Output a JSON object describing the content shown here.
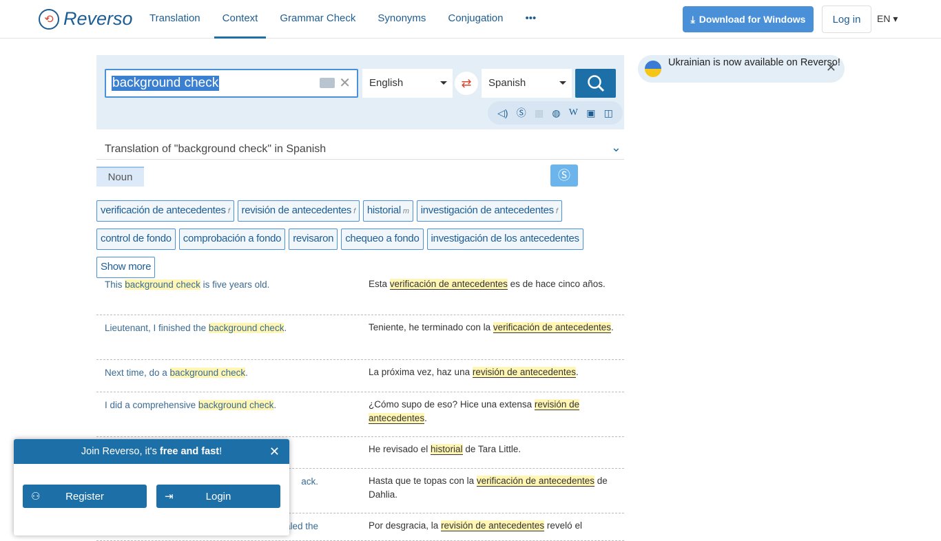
{
  "header": {
    "logo": "Reverso",
    "nav": [
      "Translation",
      "Context",
      "Grammar Check",
      "Synonyms",
      "Conjugation",
      "•••"
    ],
    "active": "Context",
    "download": "Download for Windows",
    "login": "Log in",
    "lang": "EN"
  },
  "search": {
    "query": "background check",
    "source_lang": "English",
    "target_lang": "Spanish"
  },
  "tools": [
    "speaker-icon",
    "synonyms-icon",
    "grid-icon",
    "globe-icon",
    "wikipedia-icon",
    "image-icon",
    "book-icon"
  ],
  "translation_header": "Translation of \"background check\" in Spanish",
  "pos": "Noun",
  "chips": [
    {
      "t": "verificación de antecedentes",
      "g": "f"
    },
    {
      "t": "revisión de antecedentes",
      "g": "f"
    },
    {
      "t": "historial",
      "g": "m"
    },
    {
      "t": "investigación de antecedentes",
      "g": "f"
    },
    {
      "t": "control de fondo",
      "g": ""
    },
    {
      "t": "comprobación a fondo",
      "g": ""
    },
    {
      "t": "revisaron",
      "g": ""
    },
    {
      "t": "chequeo a fondo",
      "g": ""
    },
    {
      "t": "investigación de los antecedentes",
      "g": ""
    },
    {
      "t": "Show more",
      "g": ""
    }
  ],
  "examples": [
    {
      "src": [
        "This ",
        "background check",
        " is five years old."
      ],
      "trg": [
        "Esta ",
        "verificación de antecedentes",
        " es de hace cinco años."
      ]
    },
    {
      "src": [
        "Lieutenant, I finished the ",
        "background check",
        "."
      ],
      "trg": [
        "Teniente, he terminado con la ",
        "verificación de antecedentes",
        "."
      ]
    },
    {
      "src": [
        "Next time, do a ",
        "background check",
        "."
      ],
      "trg": [
        "La próxima vez, haz una ",
        "revisión de antecedentes",
        "."
      ]
    },
    {
      "src": [
        "I did a comprehensive ",
        "background check",
        "."
      ],
      "trg": [
        "¿Cómo supo de eso? Hice una extensa ",
        "revisión de antecedentes",
        "."
      ]
    },
    {
      "src": [
        "",
        "",
        ""
      ],
      "trg": [
        "He revisado el ",
        "historial",
        " de Tara Little."
      ]
    },
    {
      "src": [
        "",
        "",
        "ack."
      ],
      "trg": [
        "Hasta que te topas con la ",
        "verificación de antecedentes",
        " de Dahlia."
      ]
    },
    {
      "src": [
        "",
        "",
        "ealed the"
      ],
      "trg": [
        "Por desgracia, la ",
        "revisión de antecedentes",
        " reveló el"
      ]
    }
  ],
  "popup": {
    "title_pre": "Join Reverso, it's ",
    "title_bold": "free and fast",
    "title_post": "!",
    "register": "Register",
    "login": "Login"
  },
  "notice": "Ukrainian is now available on Reverso!"
}
